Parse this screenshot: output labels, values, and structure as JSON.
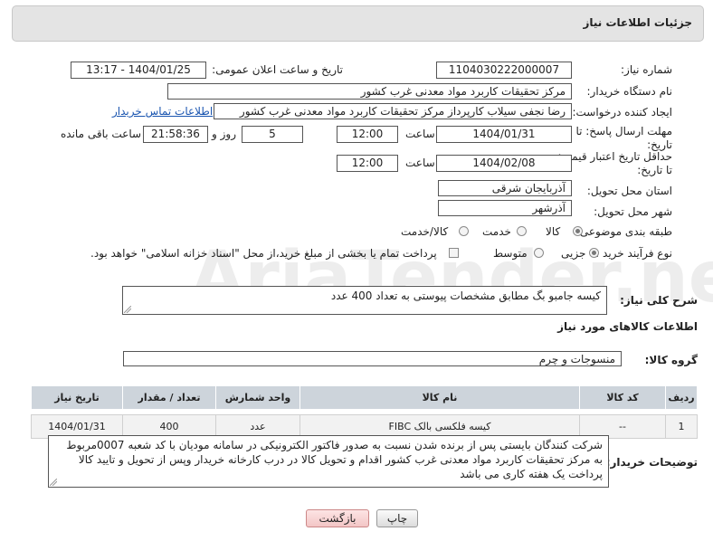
{
  "header": {
    "title": "جزئیات اطلاعات نیاز"
  },
  "fields": {
    "need_number": {
      "label": "شماره نیاز:",
      "value": "1104030222000007"
    },
    "announce_datetime": {
      "label": "تاریخ و ساعت اعلان عمومی:",
      "value": "1404/01/25 - 13:17"
    },
    "buyer_org": {
      "label": "نام دستگاه خریدار:",
      "value": "مرکز تحقیقات کاربرد مواد معدنی غرب کشور"
    },
    "creator": {
      "label": "ایجاد کننده درخواست:",
      "value": "رضا نجفی سیلاب کارپرداز مرکز تحقیقات کاربرد مواد معدنی غرب کشور",
      "contact_link": "اطلاعات تماس خریدار"
    },
    "response_deadline": {
      "label_line1": "مهلت ارسال پاسخ: تا",
      "label_line2": "تاریخ:",
      "date": "1404/01/31",
      "time_label": "ساعت",
      "time": "12:00",
      "days": "5",
      "days_label": "روز و",
      "remaining": "21:58:36",
      "remaining_label": "ساعت باقی مانده"
    },
    "price_validity": {
      "label_line1": "حداقل تاریخ اعتبار قیمت:",
      "label_line2": "تا تاریخ:",
      "date": "1404/02/08",
      "time_label": "ساعت",
      "time": "12:00"
    },
    "province": {
      "label": "استان محل تحویل:",
      "value": "آذربایجان شرقی"
    },
    "city": {
      "label": "شهر محل تحویل:",
      "value": "آذرشهر"
    },
    "category": {
      "label": "طبقه بندی موضوعی:",
      "options": [
        "کالا",
        "خدمت",
        "کالا/خدمت"
      ],
      "selected": "کالا"
    },
    "purchase_type": {
      "label": "نوع فرآیند خرید :",
      "options": [
        "جزیی",
        "متوسط"
      ],
      "selected": "جزیی",
      "payment_note": "پرداخت تمام یا بخشی از مبلغ خرید،از محل \"اسناد خزانه اسلامی\" خواهد بود."
    }
  },
  "description": {
    "label": "شرح کلی نیاز:",
    "value": "کیسه جامبو بگ مطابق مشخصات پیوستی به تعداد 400 عدد"
  },
  "goods_section": {
    "title": "اطلاعات کالاهای مورد نیاز",
    "group_label": "گروه کالا:",
    "group_value": "منسوجات و چرم"
  },
  "table": {
    "columns": [
      "ردیف",
      "کد کالا",
      "نام کالا",
      "واحد شمارش",
      "تعداد / مقدار",
      "تاریخ نیاز"
    ],
    "rows": [
      [
        "1",
        "--",
        "کیسه فلکسی بالک FIBC",
        "عدد",
        "400",
        "1404/01/31"
      ]
    ]
  },
  "buyer_notes": {
    "label": "توضیحات خریدار:",
    "value": "شرکت کنندگان بایستی پس از برنده شدن نسبت به صدور فاکتور الکترونیکی در سامانه مودیان با کد شعبه 0007مربوط به مرکز تحقیقات کاربرد مواد معدنی غرب کشور اقدام و تحویل کالا در درب کارخانه خریدار  وپس از تحویل و تایید کالا پرداخت یک هفته کاری می باشد"
  },
  "buttons": {
    "print": "چاپ",
    "back": "بازگشت"
  },
  "watermark": {
    "text": "AriaTender.net"
  },
  "colors": {
    "link": "#1a55b0",
    "table_header": "#cdd4db",
    "panel": "#e4e4e4",
    "back_button": "#f3c6c6"
  }
}
